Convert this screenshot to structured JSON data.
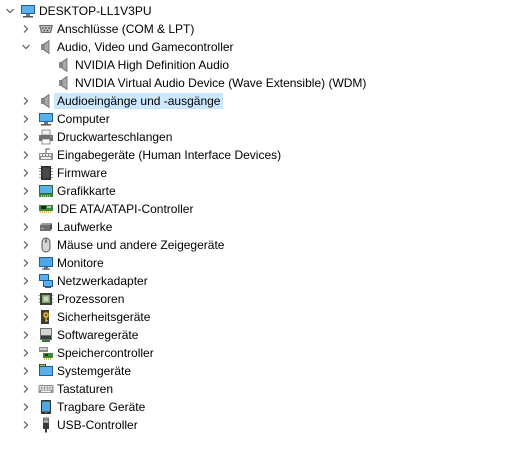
{
  "tree": {
    "root": {
      "label": "DESKTOP-LL1V3PU",
      "expanded": true
    },
    "categories": [
      {
        "label": "Anschlüsse (COM & LPT)",
        "icon": "port-icon",
        "expanded": false
      },
      {
        "label": "Audio, Video und Gamecontroller",
        "icon": "speaker-icon",
        "expanded": true,
        "children": [
          {
            "label": "NVIDIA High Definition Audio",
            "icon": "speaker-icon"
          },
          {
            "label": "NVIDIA Virtual Audio Device (Wave Extensible) (WDM)",
            "icon": "speaker-icon"
          }
        ]
      },
      {
        "label": "Audioeingänge und -ausgänge",
        "icon": "speaker-icon",
        "expanded": false,
        "selected": true
      },
      {
        "label": "Computer",
        "icon": "computer-icon",
        "expanded": false
      },
      {
        "label": "Druckwarteschlangen",
        "icon": "printer-icon",
        "expanded": false
      },
      {
        "label": "Eingabegeräte (Human Interface Devices)",
        "icon": "hid-icon",
        "expanded": false
      },
      {
        "label": "Firmware",
        "icon": "firmware-icon",
        "expanded": false
      },
      {
        "label": "Grafikkarte",
        "icon": "display-adapter-icon",
        "expanded": false
      },
      {
        "label": "IDE ATA/ATAPI-Controller",
        "icon": "ide-controller-icon",
        "expanded": false
      },
      {
        "label": "Laufwerke",
        "icon": "disk-drive-icon",
        "expanded": false
      },
      {
        "label": "Mäuse und andere Zeigegeräte",
        "icon": "mouse-icon",
        "expanded": false
      },
      {
        "label": "Monitore",
        "icon": "monitor-icon",
        "expanded": false
      },
      {
        "label": "Netzwerkadapter",
        "icon": "network-adapter-icon",
        "expanded": false
      },
      {
        "label": "Prozessoren",
        "icon": "processor-icon",
        "expanded": false
      },
      {
        "label": "Sicherheitsgeräte",
        "icon": "security-key-icon",
        "expanded": false
      },
      {
        "label": "Softwaregeräte",
        "icon": "software-device-icon",
        "expanded": false
      },
      {
        "label": "Speichercontroller",
        "icon": "storage-controller-icon",
        "expanded": false
      },
      {
        "label": "Systemgeräte",
        "icon": "system-device-icon",
        "expanded": false
      },
      {
        "label": "Tastaturen",
        "icon": "keyboard-icon",
        "expanded": false
      },
      {
        "label": "Tragbare Geräte",
        "icon": "portable-device-icon",
        "expanded": false
      },
      {
        "label": "USB-Controller",
        "icon": "usb-icon",
        "expanded": false
      }
    ]
  },
  "colors": {
    "selection": "#cce8ff",
    "expander": "#595959"
  }
}
